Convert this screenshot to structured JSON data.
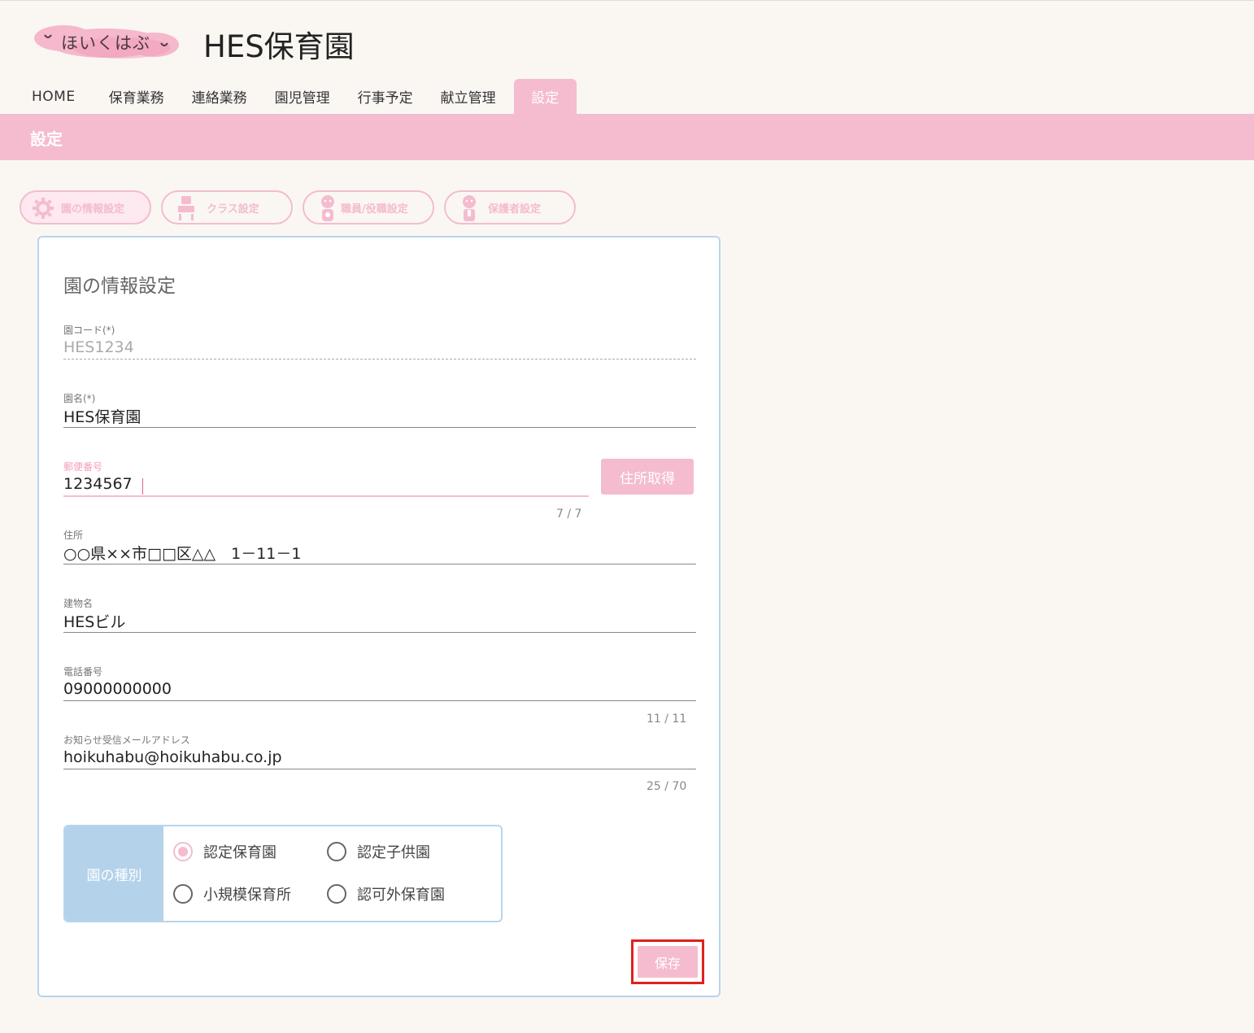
{
  "header": {
    "logo_text": "ほいくはぶ",
    "title": "HES保育園"
  },
  "nav": {
    "items": [
      "HOME",
      "保育業務",
      "連絡業務",
      "園児管理",
      "行事予定",
      "献立管理",
      "設定"
    ],
    "active": "設定"
  },
  "page": {
    "title": "設定"
  },
  "subtabs": [
    {
      "label": "園の情報設定",
      "icon": "gear-icon",
      "active": true
    },
    {
      "label": "クラス設定",
      "icon": "classroom-icon",
      "active": false
    },
    {
      "label": "職員/役職設定",
      "icon": "staff-icon",
      "active": false
    },
    {
      "label": "保護者設定",
      "icon": "guardian-icon",
      "active": false
    }
  ],
  "form": {
    "title": "園の情報設定",
    "code": {
      "label": "園コード(*)",
      "value": "HES1234"
    },
    "name": {
      "label": "園名(*)",
      "value": "HES保育園"
    },
    "zip": {
      "label": "郵便番号",
      "value": "1234567",
      "counter": "7 / 7",
      "button": "住所取得"
    },
    "address": {
      "label": "住所",
      "value": "○○県××市□□区△△　1－11－1"
    },
    "building": {
      "label": "建物名",
      "value": "HESビル"
    },
    "phone": {
      "label": "電話番号",
      "value": "09000000000",
      "counter": "11 / 11"
    },
    "email": {
      "label": "お知らせ受信メールアドレス",
      "value": "hoikuhabu@hoikuhabu.co.jp",
      "counter": "25 / 70"
    },
    "type": {
      "label": "園の種別",
      "options": [
        "認定保育園",
        "認定子供園",
        "小規模保育所",
        "認可外保育園"
      ],
      "selected": "認定保育園"
    },
    "save_label": "保存"
  },
  "colors": {
    "accent_pink": "#f4bcce",
    "accent_blue": "#b4d2ea",
    "highlight_red": "#e02020"
  }
}
